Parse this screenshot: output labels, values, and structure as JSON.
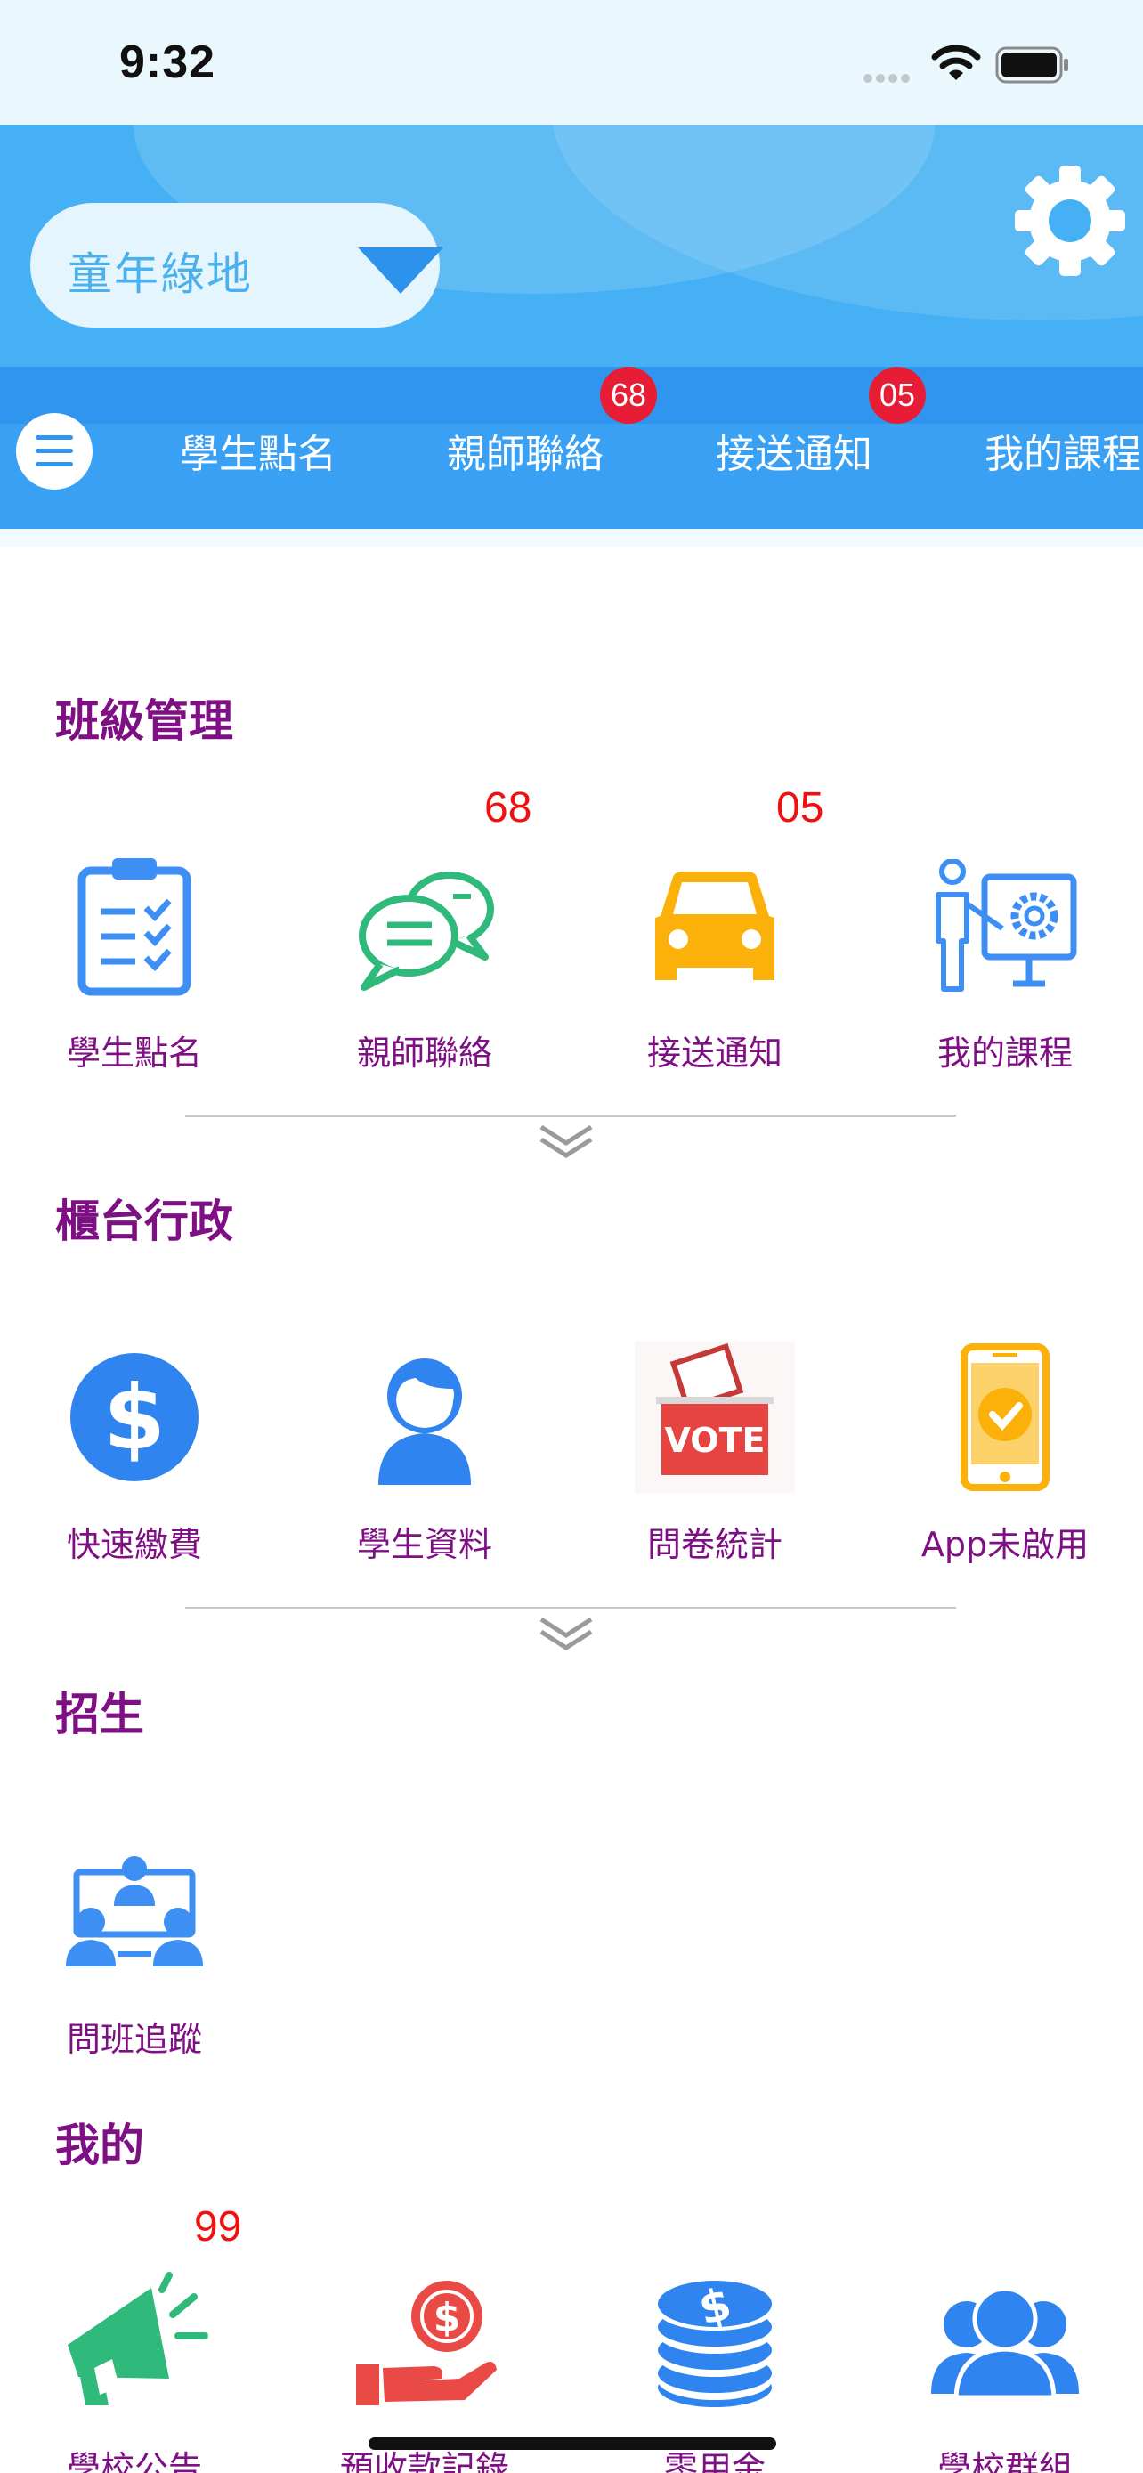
{
  "status_bar": {
    "time": "9:32",
    "icons": [
      "signal-icon",
      "wifi-icon",
      "battery-icon"
    ]
  },
  "header": {
    "school_name": "童年綠地",
    "icons": [
      "dropdown-icon",
      "gear-icon"
    ]
  },
  "nav": {
    "tabs": [
      {
        "label": "學生點名",
        "badge": ""
      },
      {
        "label": "親師聯絡",
        "badge": "68"
      },
      {
        "label": "接送通知",
        "badge": "05"
      },
      {
        "label": "我的課程",
        "badge": ""
      }
    ]
  },
  "sections": {
    "class_mgmt": {
      "title": "班級管理",
      "items": [
        {
          "label": "學生點名",
          "icon": "clipboard-checklist-icon",
          "badge": ""
        },
        {
          "label": "親師聯絡",
          "icon": "chat-bubbles-icon",
          "badge": "68"
        },
        {
          "label": "接送通知",
          "icon": "car-icon",
          "badge": "05"
        },
        {
          "label": "我的課程",
          "icon": "teacher-board-icon",
          "badge": ""
        }
      ]
    },
    "front_desk": {
      "title": "櫃台行政",
      "items": [
        {
          "label": "快速繳費",
          "icon": "dollar-coin-icon"
        },
        {
          "label": "學生資料",
          "icon": "student-person-icon"
        },
        {
          "label": "問卷統計",
          "icon": "vote-box-icon",
          "vote_text": "VOTE"
        },
        {
          "label": "App未啟用",
          "icon": "phone-check-icon"
        }
      ]
    },
    "enrollment": {
      "title": "招生",
      "items": [
        {
          "label": "問班追蹤",
          "icon": "group-meeting-icon"
        }
      ]
    },
    "mine": {
      "title": "我的",
      "items": [
        {
          "label": "學校公告",
          "icon": "megaphone-icon",
          "badge": "99"
        },
        {
          "label": "預收款記錄",
          "icon": "money-hand-icon",
          "badge": ""
        },
        {
          "label": "零用金",
          "icon": "coin-stack-icon",
          "badge": ""
        },
        {
          "label": "學校群組",
          "icon": "people-group-icon",
          "badge": ""
        }
      ]
    }
  },
  "colors": {
    "header_blue": "#45b0f3",
    "nav_blue": "#2f95ef",
    "section_purple": "#7e1084",
    "badge_red": "#e61d34",
    "count_red": "#ef1010",
    "icon_blue": "#3d8ff3",
    "icon_green": "#2fb97a",
    "icon_orange": "#fbb00a"
  }
}
